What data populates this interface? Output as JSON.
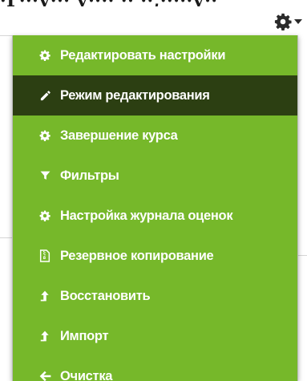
{
  "page": {
    "top_text_fragment": "·Ѓ···у··· у···· ·· ··,·····у··"
  },
  "menu": {
    "toggle": {
      "icon": "gear-icon",
      "caret_icon": "caret-down-icon"
    },
    "colors": {
      "menu_background": "#76b82a",
      "active_background": "#2c3f12",
      "text": "#ffffff"
    },
    "items": [
      {
        "label": "Редактировать настройки",
        "icon": "gear-icon",
        "active": false
      },
      {
        "label": "Режим редактирования",
        "icon": "pencil-icon",
        "active": true
      },
      {
        "label": "Завершение курса",
        "icon": "gear-icon",
        "active": false
      },
      {
        "label": "Фильтры",
        "icon": "filter-icon",
        "active": false
      },
      {
        "label": "Настройка журнала оценок",
        "icon": "gear-icon",
        "active": false
      },
      {
        "label": "Резервное копирование",
        "icon": "file-archive-icon",
        "active": false
      },
      {
        "label": "Восстановить",
        "icon": "upload-icon",
        "active": false
      },
      {
        "label": "Импорт",
        "icon": "upload-icon",
        "active": false
      },
      {
        "label": "Очистка",
        "icon": "arrow-left-icon",
        "active": false
      }
    ]
  }
}
